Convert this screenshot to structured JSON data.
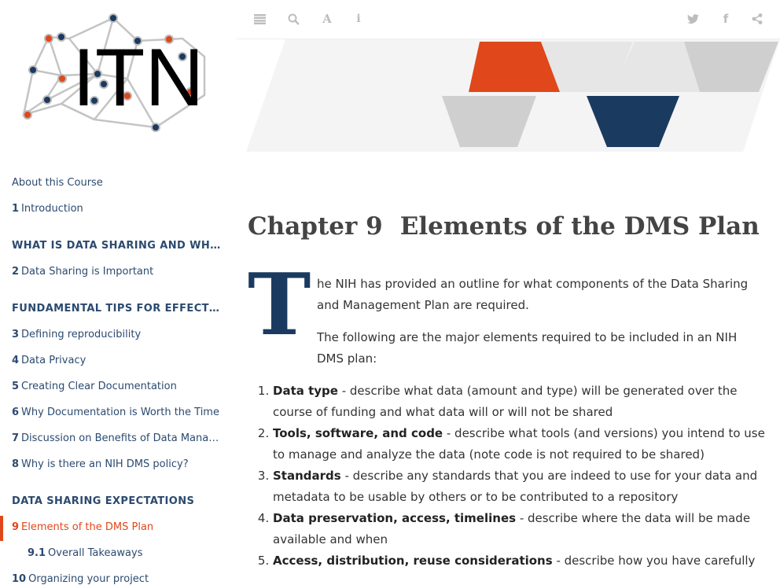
{
  "topbar": {
    "icons": [
      "toc-toggle-icon",
      "search-icon",
      "font-settings-icon",
      "info-icon",
      "twitter-icon",
      "facebook-icon",
      "share-icon"
    ]
  },
  "logo": {
    "text": "ITN"
  },
  "sidebar": {
    "items": [
      {
        "type": "item",
        "num": "",
        "label": "About this Course"
      },
      {
        "type": "item",
        "num": "1",
        "label": "Introduction"
      },
      {
        "type": "header",
        "num": "",
        "label": "WHAT IS DATA SHARING AND WHY IS IT IMPORTANT?"
      },
      {
        "type": "item",
        "num": "2",
        "label": "Data Sharing is Important"
      },
      {
        "type": "header",
        "num": "",
        "label": "FUNDAMENTAL TIPS FOR EFFECTIVE DATA SHARING"
      },
      {
        "type": "item",
        "num": "3",
        "label": "Defining reproducibility"
      },
      {
        "type": "item",
        "num": "4",
        "label": "Data Privacy"
      },
      {
        "type": "item",
        "num": "5",
        "label": "Creating Clear Documentation"
      },
      {
        "type": "item",
        "num": "6",
        "label": "Why Documentation is Worth the Time"
      },
      {
        "type": "item",
        "num": "7",
        "label": "Discussion on Benefits of Data Management"
      },
      {
        "type": "item",
        "num": "8",
        "label": "Why is there an NIH DMS policy?"
      },
      {
        "type": "header",
        "num": "",
        "label": "DATA SHARING EXPECTATIONS"
      },
      {
        "type": "active",
        "num": "9",
        "label": "Elements of the DMS Plan"
      },
      {
        "type": "sub",
        "num": "9.1",
        "label": "Overall Takeaways"
      },
      {
        "type": "item",
        "num": "10",
        "label": "Organizing your project"
      }
    ]
  },
  "main": {
    "chapter_label": "Chapter 9",
    "chapter_title": "Elements of the DMS Plan",
    "dropcap": "T",
    "intro": "he NIH has provided an outline for what components of the Data Sharing and Management Plan are required.",
    "para2": "The following are the major elements required to be included in an NIH DMS plan:",
    "list": [
      {
        "term": "Data type",
        "desc": " - describe what data (amount and type) will be generated over the course of funding and what data will or will not be shared"
      },
      {
        "term": "Tools, software, and code",
        "desc": " - describe what tools (and versions) you intend to use to manage and analyze the data (note code is not required to be shared)"
      },
      {
        "term": "Standards",
        "desc": " - describe any standards that you are indeed to use for your data and metadata to be usable by others or to be contributed to a repository"
      },
      {
        "term": "Data preservation, access, timelines",
        "desc": " - describe where the data will be made available and when"
      },
      {
        "term": "Access, distribution, reuse considerations",
        "desc": " - describe how you have carefully"
      }
    ]
  },
  "colors": {
    "accent": "#e0471a",
    "navy": "#1b3a5f",
    "link": "#2b4a6f",
    "gray": "#cccccc"
  }
}
